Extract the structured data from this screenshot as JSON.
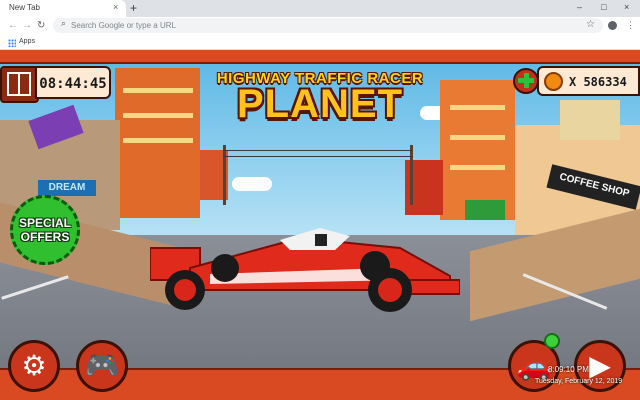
{
  "browser": {
    "tab_title": "New Tab",
    "tab_close": "×",
    "new_tab": "+",
    "omnibox_placeholder": "Search Google or type a URL",
    "bookmark_apps": "Apps",
    "window_controls": [
      "–",
      "□",
      "×"
    ]
  },
  "game": {
    "title_line1": "HIGHWAY TRAFFIC RACER",
    "title_line2": "PLANET",
    "timer": "08:44:45",
    "coins": "X 586334",
    "special_offers_line1": "SPECIAL",
    "special_offers_line2": "OFFERS",
    "shop_sign": "COFFEE SHOP",
    "dream_sign": "DREAM",
    "colors": {
      "accent_red": "#d94a22",
      "panel_cream": "#fde9d4",
      "title_yellow": "#ffc21c",
      "offer_green": "#2fbf2f",
      "car_red": "#e02a1c"
    }
  },
  "system_clock": {
    "time": "8:09:10 PM",
    "date": "Tuesday, February 12, 2019"
  },
  "icons": {
    "settings": "gear-icon",
    "gamepad": "gamepad-icon",
    "garage": "car-icon",
    "play": "play-icon"
  }
}
